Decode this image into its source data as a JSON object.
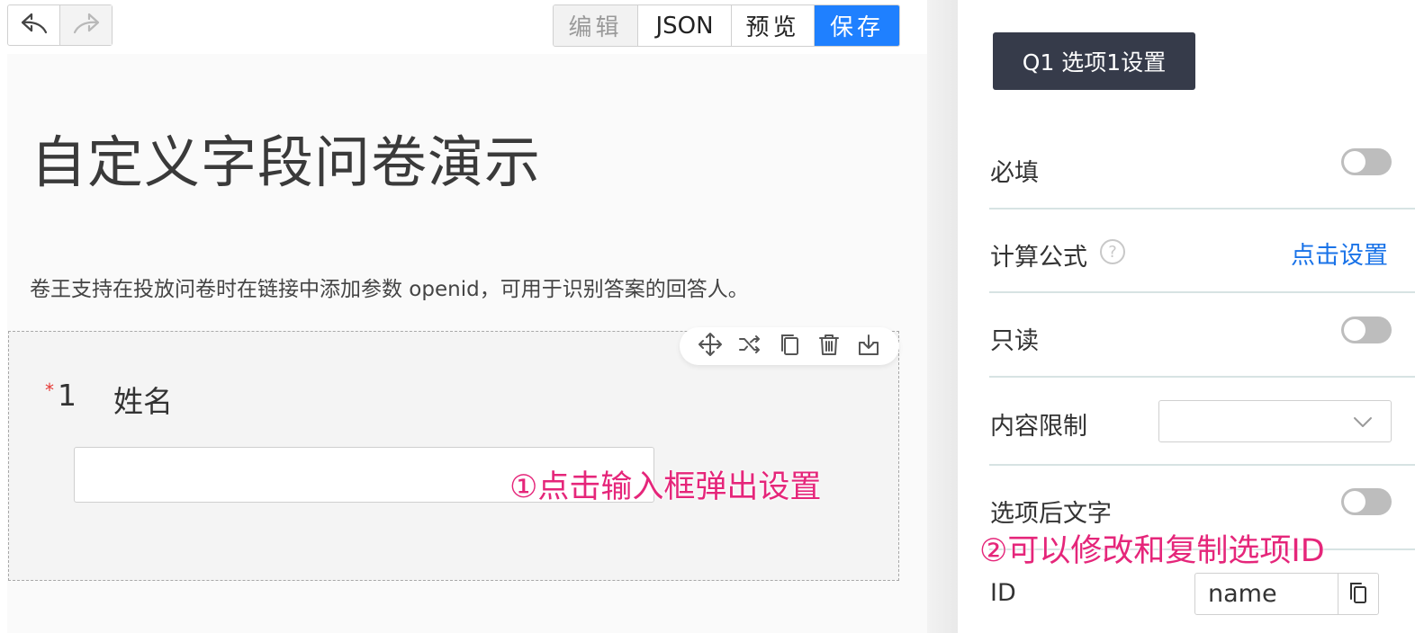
{
  "toolbar": {
    "undo_icon": "undo-icon",
    "redo_icon": "redo-icon",
    "modes": {
      "edit": "编辑",
      "json": "JSON",
      "preview": "预览",
      "save": "保存"
    },
    "save_color": "#1f80ff"
  },
  "survey": {
    "title": "自定义字段问卷演示",
    "description": "卷王支持在投放问卷时在链接中添加参数 openid，可用于识别答案的回答人。"
  },
  "question": {
    "required_mark": "*",
    "number": "1",
    "title": "姓名",
    "input_value": "",
    "tools": [
      "move-icon",
      "shuffle-icon",
      "copy-icon",
      "delete-icon",
      "save-to-bank-icon"
    ]
  },
  "annotations": {
    "step1": "①点击输入框弹出设置",
    "step2": "②可以修改和复制选项ID",
    "color": "#e5267a"
  },
  "panel": {
    "badge": "Q1 选项1设置",
    "rows": {
      "required": {
        "label": "必填",
        "on": false
      },
      "formula": {
        "label": "计算公式",
        "link": "点击设置"
      },
      "readonly": {
        "label": "只读",
        "on": false
      },
      "content_limit": {
        "label": "内容限制",
        "value": ""
      },
      "after_text": {
        "label": "选项后文字",
        "on": false
      },
      "id": {
        "label": "ID",
        "value": "name"
      }
    },
    "link_color": "#1a73e8"
  }
}
